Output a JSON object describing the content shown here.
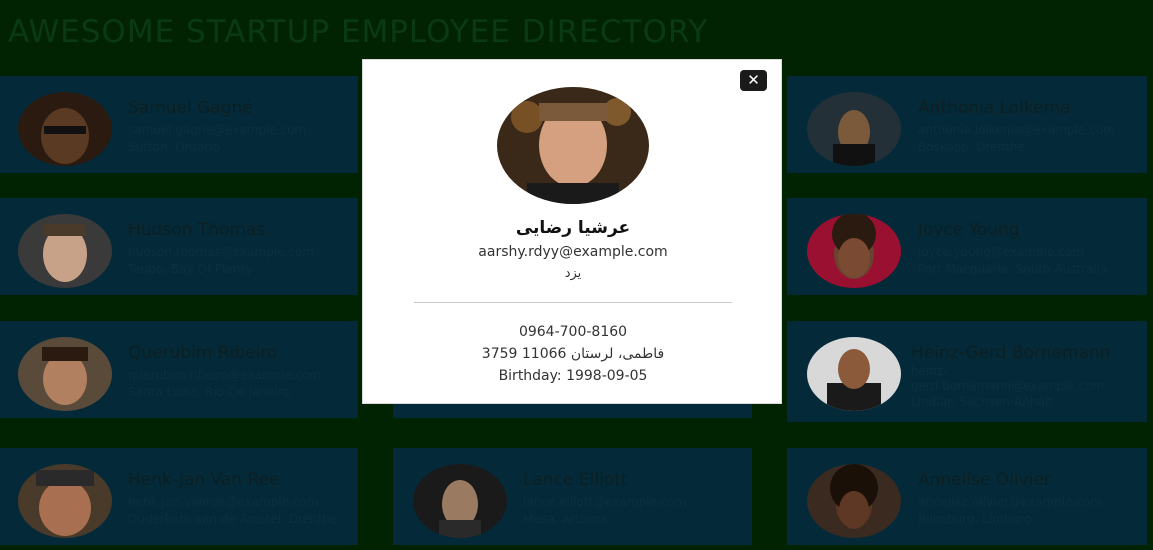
{
  "page": {
    "title": "AWESOME STARTUP EMPLOYEE DIRECTORY"
  },
  "employees": [
    {
      "name": "Samuel Gagné",
      "email": "samuel.gagne@example.com",
      "location": "Sutton, Ontario"
    },
    {
      "name": "Anthonia Lolkema",
      "email": "anthonia.lolkema@example.com",
      "location": "Boskoop, Drenthe"
    },
    {
      "name": "Hudson Thomas",
      "email": "hudson.thomas@example.com",
      "location": "Taupo, Bay Of Plenty"
    },
    {
      "name": "Joyce Young",
      "email": "joyce.young@example.com",
      "location": "Port Macquarie, South Australia"
    },
    {
      "name": "Querubim Ribeiro",
      "email": "querubim.ribeiro@example.com",
      "location": "Santa Luzia, Rio De Janeiro"
    },
    {
      "name": "Heinz-Gerd Bornemann",
      "email": "heinz-gerd.bornemann@example.com",
      "location": "Lindlar, Sachsen-Anhalt"
    },
    {
      "name": "Henk-Jan Van Ree",
      "email": "henk-jan.vanree@example.com",
      "location": "Ouderkerk aan de Amstel, Drenthe"
    },
    {
      "name": "Lance Elliott",
      "email": "lance.elliott@example.com",
      "location": "Mesa, Arizona"
    },
    {
      "name": "Annelise Olivier",
      "email": "annelise.olivier@example.com",
      "location": "Rijnsburg, Limburg"
    }
  ],
  "modal": {
    "close_label": "✕",
    "name": "عرشیا رضایی",
    "email": "aarshy.rdyy@example.com",
    "city": "یزد",
    "phone": "0964-700-8160",
    "address": "3759 فاطمی، لرستان 11066",
    "birthday": "Birthday: 1998-09-05"
  }
}
